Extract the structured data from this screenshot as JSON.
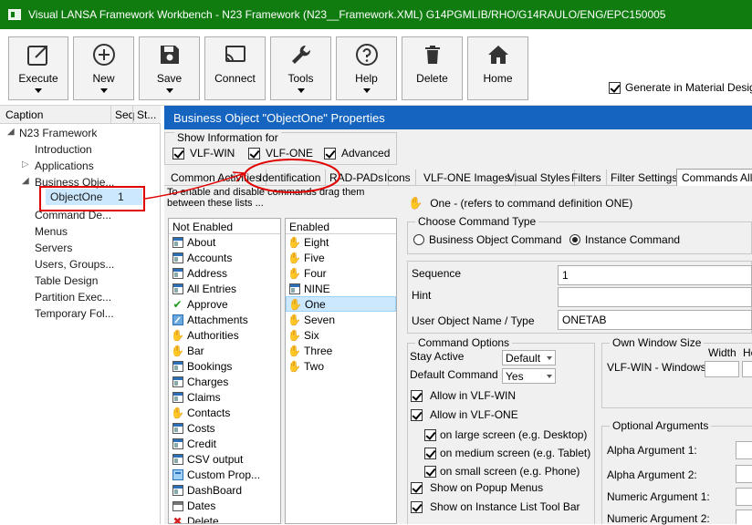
{
  "window": {
    "title": "Visual LANSA Framework Workbench - N23 Framework (N23__Framework.XML)     G14PGMLIB/RHO/G14RAULO/ENG/EPC150005"
  },
  "ribbon": {
    "buttons": [
      {
        "label": "Execute",
        "icon": "execute-icon"
      },
      {
        "label": "New",
        "icon": "plus-circle-icon"
      },
      {
        "label": "Save",
        "icon": "floppy-icon"
      },
      {
        "label": "Connect",
        "icon": "cast-icon"
      },
      {
        "label": "Tools",
        "icon": "wrench-icon"
      },
      {
        "label": "Help",
        "icon": "question-icon"
      },
      {
        "label": "Delete",
        "icon": "trash-icon"
      },
      {
        "label": "Home",
        "icon": "house-icon"
      }
    ],
    "generate_material": {
      "label": "Generate in Material Desig",
      "checked": true
    }
  },
  "tree": {
    "columns": [
      "Caption",
      "Seq",
      "St..."
    ],
    "items": [
      {
        "label": "N23 Framework"
      },
      {
        "label": "Introduction"
      },
      {
        "label": "Applications"
      },
      {
        "label": "Business Obje..."
      },
      {
        "label": "ObjectOne",
        "seq": "1"
      },
      {
        "label": "Command De..."
      },
      {
        "label": "Menus"
      },
      {
        "label": "Servers"
      },
      {
        "label": "Users, Groups..."
      },
      {
        "label": "Table Design"
      },
      {
        "label": "Partition Exec..."
      },
      {
        "label": "Temporary Fol..."
      }
    ]
  },
  "main": {
    "header": "Business Object \"ObjectOne\" Properties",
    "show_info": {
      "legend": "Show Information for",
      "options": [
        {
          "label": "VLF-WIN",
          "checked": true
        },
        {
          "label": "VLF-ONE",
          "checked": true
        },
        {
          "label": "Advanced",
          "checked": true
        }
      ]
    },
    "tabs": [
      "Common Activities",
      "Identification",
      "RAD-PADs",
      "Icons",
      "VLF-ONE Images",
      "Visual Styles",
      "Filters",
      "Filter Settings",
      "Commands Allow"
    ],
    "help_text_1": "To enable and disable commands drag them",
    "help_text_2": "between these lists ...",
    "not_enabled": {
      "header": "Not Enabled",
      "items": [
        "About",
        "Accounts",
        "Address",
        "All Entries",
        "Approve",
        "Attachments",
        "Authorities",
        "Bar",
        "Bookings",
        "Charges",
        "Claims",
        "Contacts",
        "Costs",
        "Credit",
        "CSV output",
        "Custom Prop...",
        "DashBoard",
        "Dates",
        "Delete"
      ]
    },
    "enabled": {
      "header": "Enabled",
      "items": [
        "Eight",
        "Five",
        "Four",
        "NINE",
        "One",
        "Seven",
        "Six",
        "Three",
        "Two"
      ],
      "selected": "One"
    },
    "command_def": "One - (refers to command definition ONE)",
    "choose_type": {
      "legend": "Choose Command Type",
      "options": [
        {
          "label": "Business Object Command",
          "selected": false
        },
        {
          "label": "Instance Command",
          "selected": true
        }
      ]
    },
    "fields": {
      "sequence_label": "Sequence",
      "sequence_value": "1",
      "hint_label": "Hint",
      "hint_value": "",
      "uon_label": "User Object Name / Type",
      "uon_value": "ONETAB"
    },
    "command_options": {
      "legend": "Command Options",
      "stay_active_label": "Stay Active",
      "stay_active_value": "Default",
      "default_command_label": "Default Command",
      "default_command_value": "Yes",
      "checks": [
        {
          "label": "Allow in VLF-WIN",
          "checked": true
        },
        {
          "label": "Allow in VLF-ONE",
          "checked": true
        },
        {
          "label": "on large screen (e.g. Desktop)",
          "checked": true
        },
        {
          "label": "on medium screen (e.g. Tablet)",
          "checked": true
        },
        {
          "label": "on small screen (e.g. Phone)",
          "checked": true
        },
        {
          "label": "Show on Popup Menus",
          "checked": true
        },
        {
          "label": "Show on Instance List Tool Bar",
          "checked": true
        }
      ]
    },
    "own_window": {
      "legend": "Own Window Size",
      "width_label": "Width",
      "height_label": "He",
      "row_label": "VLF-WIN - Windows"
    },
    "optional_args": {
      "legend": "Optional Arguments",
      "labels": [
        "Alpha Argument 1:",
        "Alpha Argument 2:",
        "Numeric Argument 1:",
        "Numeric Argument 2:"
      ]
    }
  },
  "colors": {
    "titlebar": "#107c10",
    "header": "#1565c0",
    "annotation": "#e00000"
  }
}
